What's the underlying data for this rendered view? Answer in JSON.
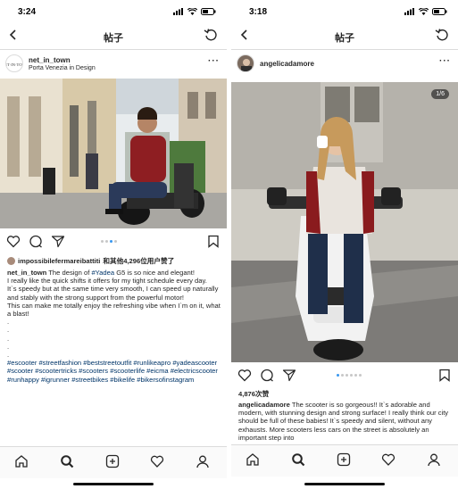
{
  "left": {
    "status_time": "3:24",
    "nav_title": "帖子",
    "username": "net_in_town",
    "location": "Porta Venezia in Design",
    "liked_by_user": "impossibilefermareibattiti",
    "liked_by_rest": "和其他4,296位用户赞了",
    "caption_user": "net_in_town",
    "caption_lines": [
      "The design of",
      "#Yadea",
      "G5 is so nice and elegant!",
      "I really like the quick shifts it offers for my tight schedule every day.",
      "It`s speedy but at the same time very smooth, I can speed up naturally and stably with the strong support from the powerful motor!",
      "This can make me totally enjoy the refreshing vibe when I`m on it, what a blast!"
    ],
    "dot_lines": [
      ".",
      ".",
      ".",
      ".",
      "."
    ],
    "hashtags": "#escooter  #streetfashion #beststreetoutfit #runlikeapro #yadeascooter #scooter #scootertricks #scooters #scooterlife  #eicma #electricscooter #runhappy #igrunner #streetbikes #bikelife #bikersofinstagram",
    "carousel_dots": 4,
    "carousel_active": 3
  },
  "right": {
    "status_time": "3:18",
    "nav_title": "帖子",
    "username": "angelicadamore",
    "photo_counter": "1/6",
    "likes": "4,876次赞",
    "caption_user": "angelicadamore",
    "caption_text": "The scooter is so gorgeous!! It`s adorable and modern, with stunning design and strong surface! I really think our city should be full of these babies! It`s speedy and silent, without any exhausts. More scooters less cars on the street is absolutely an important step into",
    "carousel_dots": 6,
    "carousel_active": 0
  },
  "icons": {
    "back": "chevron-left-icon",
    "refresh": "refresh-icon",
    "heart": "heart-icon",
    "comment": "comment-icon",
    "share": "share-icon",
    "bookmark": "bookmark-icon",
    "home": "home-icon",
    "search": "search-icon",
    "add": "add-icon",
    "activity": "heart-icon",
    "profile": "profile-icon"
  },
  "colors": {
    "link": "#003569",
    "dot_active": "#3897f0",
    "border": "#dbdbdb"
  }
}
